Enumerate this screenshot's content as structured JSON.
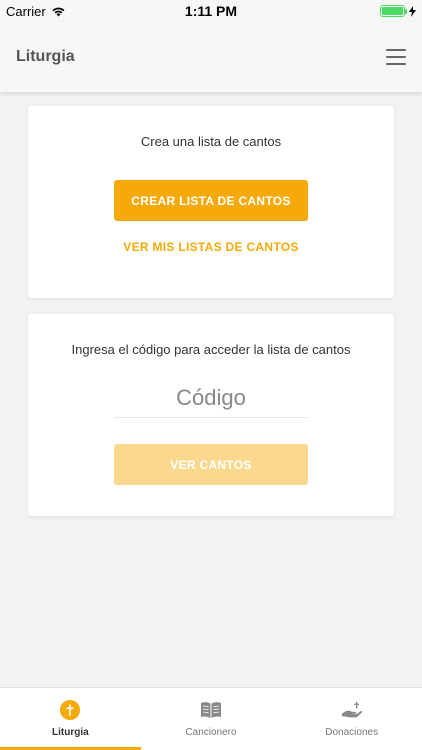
{
  "status_bar": {
    "carrier": "Carrier",
    "time": "1:11 PM"
  },
  "header": {
    "title": "Liturgia",
    "menu_icon": "hamburger-icon"
  },
  "create_card": {
    "text": "Crea una lista de cantos",
    "create_button": "CREAR LISTA DE CANTOS",
    "view_lists_link": "VER MIS LISTAS DE CANTOS"
  },
  "code_card": {
    "text": "Ingresa el código para acceder la lista de cantos",
    "code_placeholder": "Código",
    "view_button": "VER CANTOS"
  },
  "tabs": [
    {
      "label": "Liturgia",
      "icon": "cross-icon",
      "active": true
    },
    {
      "label": "Cancionero",
      "icon": "book-icon",
      "active": false
    },
    {
      "label": "Donaciones",
      "icon": "donation-hand-icon",
      "active": false
    }
  ],
  "colors": {
    "accent": "#f5a90a",
    "accent_disabled": "#fad98f",
    "battery": "#4cd964"
  }
}
